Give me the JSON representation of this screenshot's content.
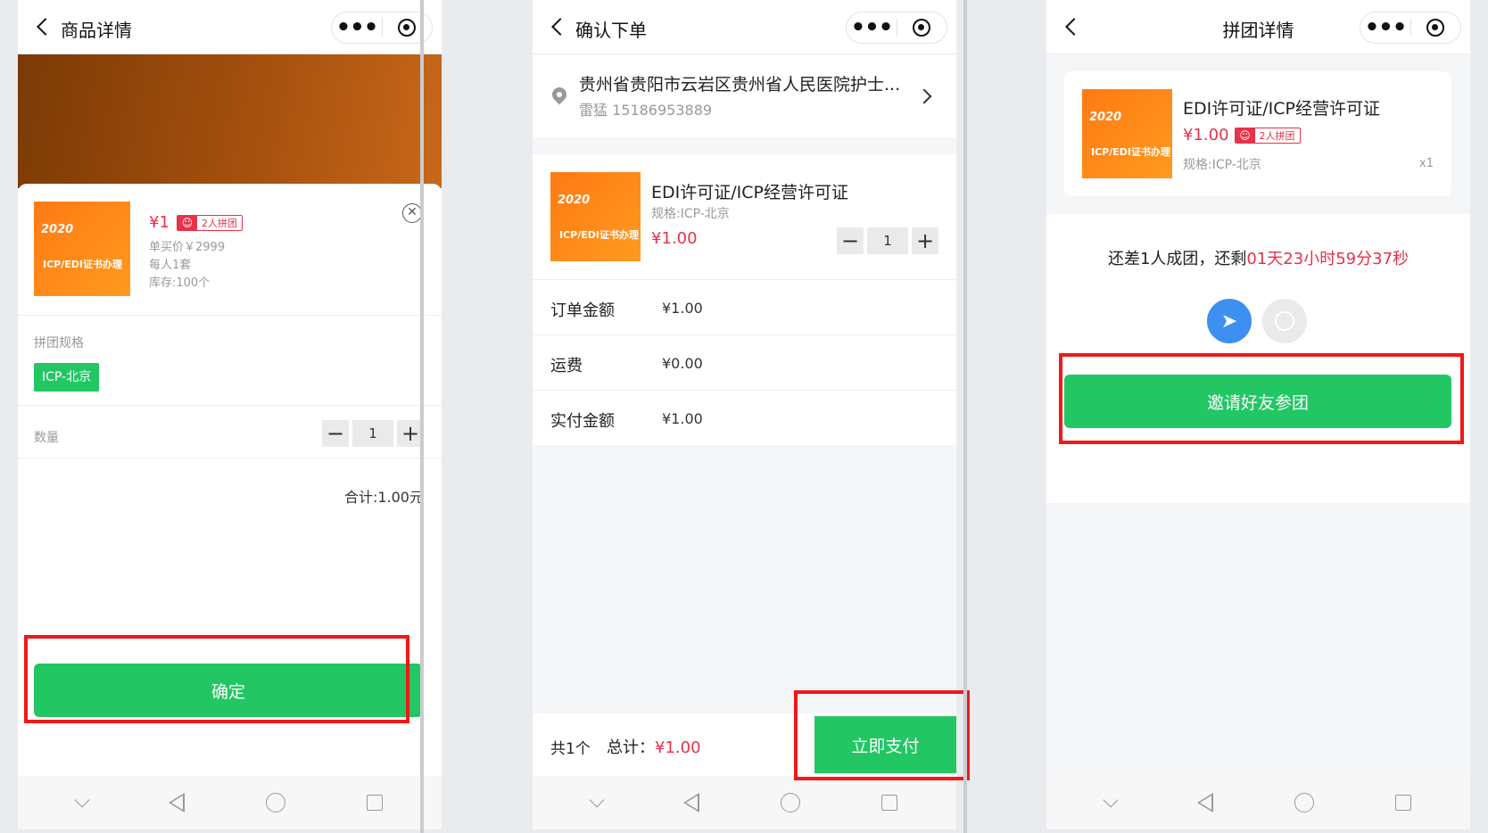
{
  "colors": {
    "green": "#22c764",
    "red": "#e8314a",
    "highlight": "#f21818"
  },
  "common": {
    "product_name": "EDI许可证/ICP经营许可证",
    "thumb_year": "2020",
    "thumb_text": "ICP/EDI证书办理",
    "group_badge": "2人拼团",
    "group_icon": "people-icon",
    "more_glyph": "•••"
  },
  "screen1": {
    "title": "商品详情",
    "price": "¥1",
    "single_price": "单买价￥2999",
    "per_person": "每人1套",
    "stock": "库存:100个",
    "spec_label": "拼团规格",
    "spec_value": "ICP-北京",
    "qty_label": "数量",
    "qty": "1",
    "total": "合计:1.00元",
    "confirm": "确定",
    "close_glyph": "✕"
  },
  "screen2": {
    "title": "确认下单",
    "address": "贵州省贵阳市云岩区贵州省人民医院护士...",
    "contact": "雷猛 15186953889",
    "spec": "规格:ICP-北京",
    "price": "¥1.00",
    "qty": "1",
    "rows": [
      {
        "label": "订单金额",
        "value": "¥1.00"
      },
      {
        "label": "运费",
        "value": "¥0.00"
      },
      {
        "label": "实付金额",
        "value": "¥1.00"
      }
    ],
    "count": "共1个",
    "total_label": "总计：",
    "total_value": "¥1.00",
    "pay": "立即支付"
  },
  "screen3": {
    "title": "拼团详情",
    "price": "¥1.00",
    "spec": "规格:ICP-北京",
    "qty": "x1",
    "status_prefix": "还差1人成团，还剩",
    "countdown": "01天23小时59分37秒",
    "invite": "邀请好友参团"
  }
}
